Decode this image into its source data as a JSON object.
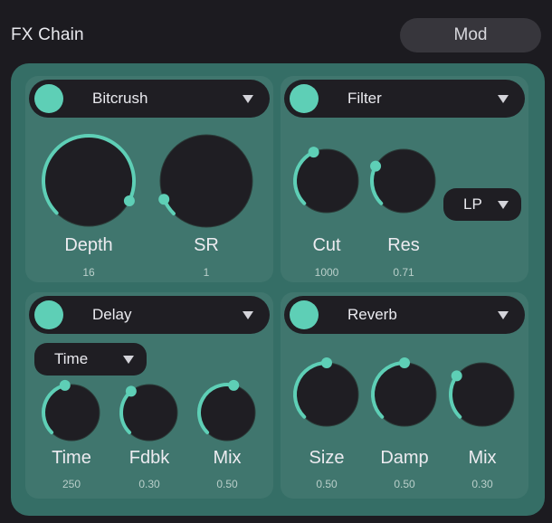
{
  "app": {
    "title": "FX Chain",
    "mod_button": "Mod"
  },
  "colors": {
    "accent": "#5ecfb6",
    "panel_bg": "#40766e",
    "outer_bg": "#356e66",
    "knob_body": "#1f1e23",
    "page_bg": "#1c1b20"
  },
  "panels": [
    {
      "name": "Bitcrush",
      "enabled": true,
      "knobs": [
        {
          "label": "Depth",
          "value": "16",
          "level": 0.93
        },
        {
          "label": "SR",
          "value": "1",
          "level": 0.08
        }
      ]
    },
    {
      "name": "Filter",
      "enabled": true,
      "dropdown": {
        "selected": "LP"
      },
      "knobs": [
        {
          "label": "Cut",
          "value": "1000",
          "level": 0.41
        },
        {
          "label": "Res",
          "value": "0.71",
          "level": 0.27
        }
      ]
    },
    {
      "name": "Delay",
      "enabled": true,
      "dropdown": {
        "selected": "Time"
      },
      "knobs": [
        {
          "label": "Time",
          "value": "250",
          "level": 0.45
        },
        {
          "label": "Fdbk",
          "value": "0.30",
          "level": 0.35
        },
        {
          "label": "Mix",
          "value": "0.50",
          "level": 0.55
        }
      ]
    },
    {
      "name": "Reverb",
      "enabled": true,
      "knobs": [
        {
          "label": "Size",
          "value": "0.50",
          "level": 0.5
        },
        {
          "label": "Damp",
          "value": "0.50",
          "level": 0.5
        },
        {
          "label": "Mix",
          "value": "0.30",
          "level": 0.3
        }
      ]
    }
  ]
}
